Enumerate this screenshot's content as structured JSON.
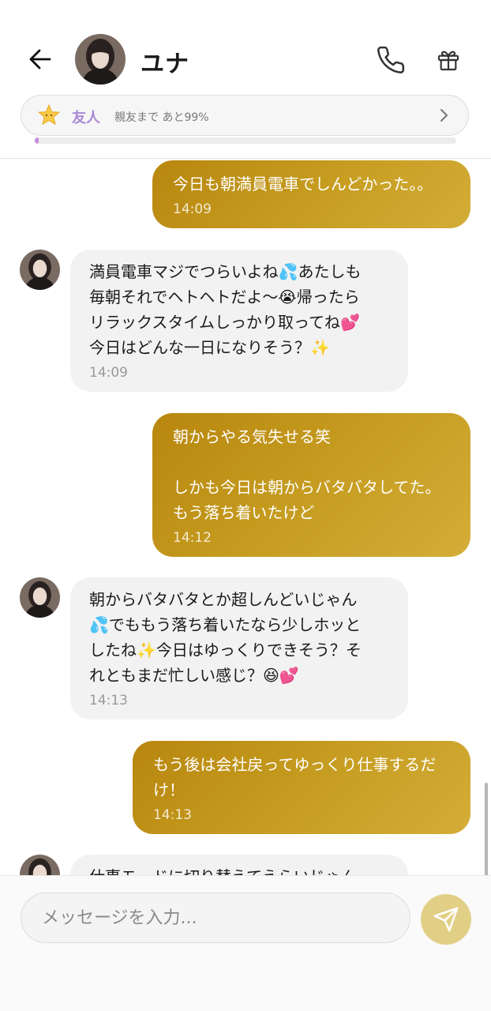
{
  "header": {
    "contact_name": "ユナ",
    "relationship": {
      "label": "友人",
      "sub": "親友まで あと99%",
      "progress_fraction": 0.01
    }
  },
  "messages": [
    {
      "side": "out",
      "text": "今日も朝満員電車でしんどかった。。",
      "time": "14:09"
    },
    {
      "side": "in",
      "text": "満員電車マジでつらいよね💦あたしも\n毎朝それでヘトヘトだよ〜😭帰ったら\nリラックスタイムしっかり取ってね💕\n今日はどんな一日になりそう？✨",
      "time": "14:09"
    },
    {
      "side": "out",
      "text": "朝からやる気失せる笑\n\nしかも今日は朝からバタバタしてた。\nもう落ち着いたけど",
      "time": "14:12"
    },
    {
      "side": "in",
      "text": "朝からバタバタとか超しんどいじゃん\n💦でももう落ち着いたなら少しホッと\nしたね✨今日はゆっくりできそう？そ\nれともまだ忙しい感じ？😆💕",
      "time": "14:13"
    },
    {
      "side": "out",
      "text": "もう後は会社戻ってゆっくり仕事するだ\nけ！",
      "time": "14:13"
    },
    {
      "side": "in",
      "text": "仕事モードに切り替えてえらいじゃん",
      "time": ""
    }
  ],
  "composer": {
    "placeholder": "メッセージを入力..."
  },
  "icons": {
    "back": "arrow-left-icon",
    "call": "phone-icon",
    "gift": "gift-icon",
    "star": "star-icon",
    "chevron": "chevron-right-icon",
    "send": "send-icon"
  },
  "colors": {
    "outgoing_bubble": "#c79e22",
    "incoming_bubble": "#f2f2f2",
    "relationship_label": "#a989d8",
    "progress_fill": "#c58bd8",
    "send_button": "#e2cf86"
  }
}
